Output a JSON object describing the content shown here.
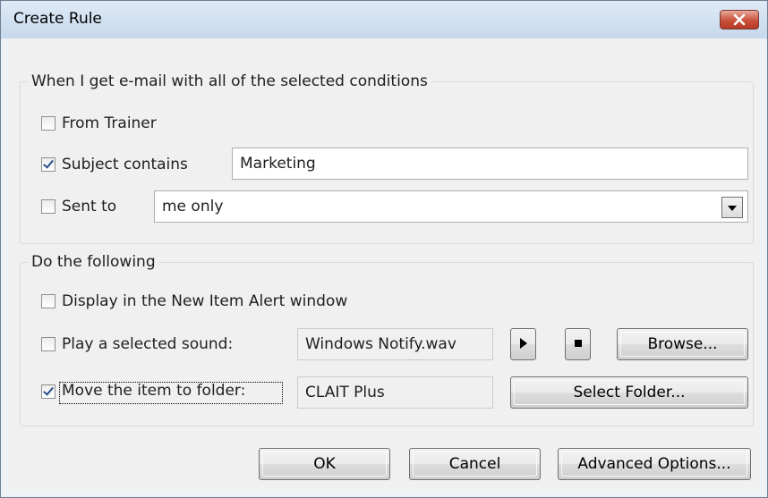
{
  "window": {
    "title": "Create Rule"
  },
  "conditions": {
    "legend": "When I get e-mail with all of the selected conditions",
    "from": {
      "label": "From Trainer",
      "checked": false
    },
    "subject": {
      "label": "Subject contains",
      "checked": true,
      "value": "Marketing"
    },
    "sent_to": {
      "label": "Sent to",
      "checked": false,
      "value": "me only"
    }
  },
  "actions": {
    "legend": "Do the following",
    "alert": {
      "label": "Display in the New Item Alert window",
      "checked": false
    },
    "sound": {
      "label": "Play a selected sound:",
      "checked": false,
      "value": "Windows Notify.wav",
      "browse_label": "Browse...",
      "play_icon": "play-icon",
      "stop_icon": "stop-icon"
    },
    "move": {
      "label": "Move the item to folder:",
      "checked": true,
      "value": "CLAIT Plus",
      "select_label": "Select Folder..."
    }
  },
  "buttons": {
    "ok": "OK",
    "cancel": "Cancel",
    "advanced": "Advanced Options..."
  },
  "colors": {
    "close_button": "#c9503a",
    "check_mark": "#2b4f8c"
  }
}
